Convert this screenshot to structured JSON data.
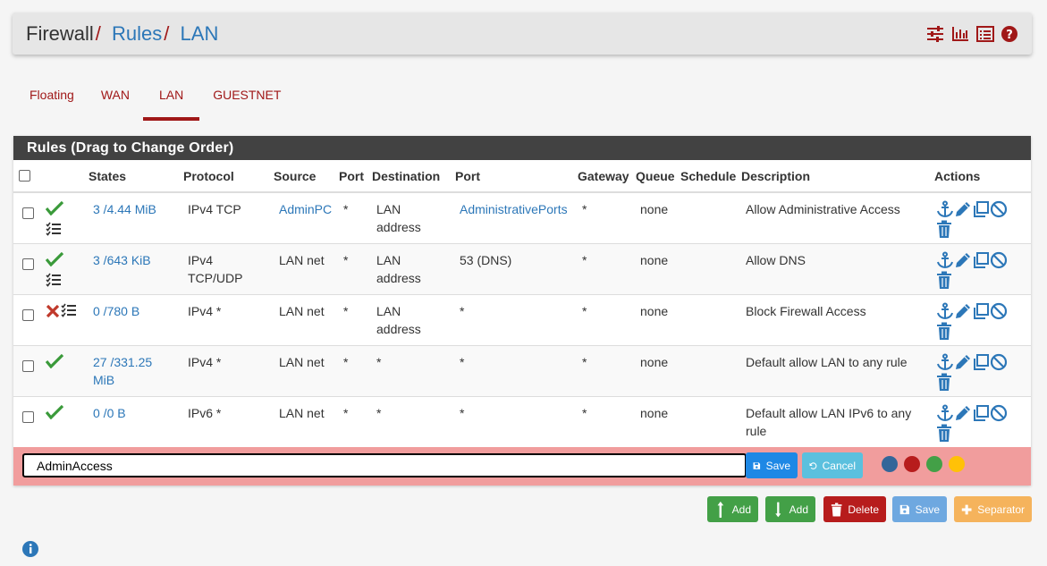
{
  "breadcrumb": {
    "root": "Firewall",
    "sep": "/",
    "rules": "Rules",
    "current": "LAN"
  },
  "tabs": [
    "Floating",
    "WAN",
    "LAN",
    "GUESTNET"
  ],
  "active_tab": "LAN",
  "panel_title": "Rules (Drag to Change Order)",
  "columns": {
    "states": "States",
    "protocol": "Protocol",
    "source": "Source",
    "port": "Port",
    "destination": "Destination",
    "dport": "Port",
    "gateway": "Gateway",
    "queue": "Queue",
    "schedule": "Schedule",
    "description": "Description",
    "actions": "Actions"
  },
  "rules": [
    {
      "status": "pass",
      "states": "3 /4.44 MiB",
      "protocol": "IPv4 TCP",
      "source": "AdminPC",
      "source_link": true,
      "port": "*",
      "destination": "LAN address",
      "dport": "AdministrativePorts",
      "dport_link": true,
      "gateway": "*",
      "queue": "none",
      "schedule": "",
      "description": "Allow Administrative Access"
    },
    {
      "status": "pass",
      "states": "3 /643 KiB",
      "protocol": "IPv4 TCP/UDP",
      "source": "LAN net",
      "source_link": false,
      "port": "*",
      "destination": "LAN address",
      "dport": "53 (DNS)",
      "dport_link": false,
      "gateway": "*",
      "queue": "none",
      "schedule": "",
      "description": "Allow DNS"
    },
    {
      "status": "block",
      "states": "0 /780 B",
      "protocol": "IPv4 *",
      "source": "LAN net",
      "source_link": false,
      "port": "*",
      "destination": "LAN address",
      "dport": "*",
      "dport_link": false,
      "gateway": "*",
      "queue": "none",
      "schedule": "",
      "description": "Block Firewall Access"
    },
    {
      "status": "pass",
      "states": "27 /331.25 MiB",
      "protocol": "IPv4 *",
      "source": "LAN net",
      "source_link": false,
      "port": "*",
      "destination": "*",
      "dport": "*",
      "dport_link": false,
      "gateway": "*",
      "queue": "none",
      "schedule": "",
      "description": "Default allow LAN to any rule"
    },
    {
      "status": "pass",
      "states": "0 /0 B",
      "protocol": "IPv6 *",
      "source": "LAN net",
      "source_link": false,
      "port": "*",
      "destination": "*",
      "dport": "*",
      "dport_link": false,
      "gateway": "*",
      "queue": "none",
      "schedule": "",
      "description": "Default allow LAN IPv6 to any rule"
    }
  ],
  "separator": {
    "input_value": "AdminAccess",
    "save_label": "Save",
    "cancel_label": "Cancel",
    "color_options": [
      "#336699",
      "#b71c1c",
      "#43a047",
      "#ffc107"
    ]
  },
  "bottom_buttons": {
    "add_top": "Add",
    "add_bottom": "Add",
    "delete": "Delete",
    "save": "Save",
    "separator": "Separator"
  },
  "colors": {
    "pass": "#3a9a3a",
    "block": "#c0392b",
    "link": "#2c77b8",
    "accent": "#a01818",
    "success": "#43a047",
    "danger": "#b71c1c",
    "primary": "#1e88e5",
    "info": "#5bc0de",
    "warning": "#f0ad4e"
  },
  "icons": {
    "header": [
      "sliders-icon",
      "bar-chart-icon",
      "list-icon",
      "help-icon"
    ],
    "row_actions": [
      "anchor-icon",
      "pencil-icon",
      "copy-icon",
      "ban-icon",
      "trash-icon"
    ]
  }
}
